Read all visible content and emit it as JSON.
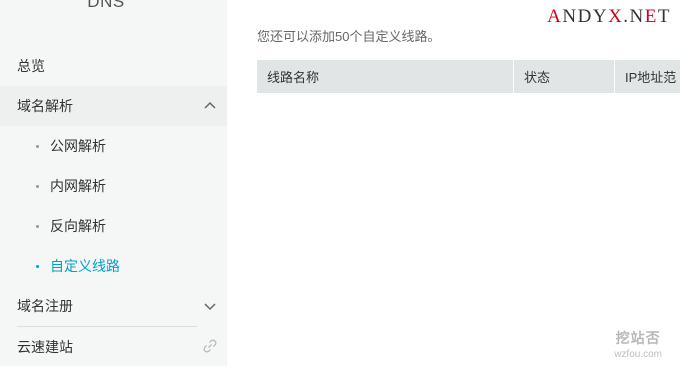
{
  "sidebar": {
    "title": "DNS",
    "items": [
      {
        "label": "总览"
      },
      {
        "label": "域名解析"
      },
      {
        "label": "域名注册"
      },
      {
        "label": "云速建站"
      }
    ],
    "sub_items": [
      {
        "label": "公网解析"
      },
      {
        "label": "内网解析"
      },
      {
        "label": "反向解析"
      },
      {
        "label": "自定义线路"
      }
    ]
  },
  "main": {
    "hint": "您还可以添加50个自定义线路。",
    "columns": [
      "线路名称",
      "状态",
      "IP地址范"
    ]
  },
  "watermark": {
    "brand_red": "A",
    "brand_dark": "NDY",
    "brand_red2": "X",
    "brand_dark2": ".N",
    "brand_red3": "E",
    "brand_dark3": "T",
    "logo_text": "挖站否",
    "logo_url": "wzfou.com"
  },
  "colors": {
    "accent": "#00a2ca",
    "brand_red": "#d0021b"
  }
}
